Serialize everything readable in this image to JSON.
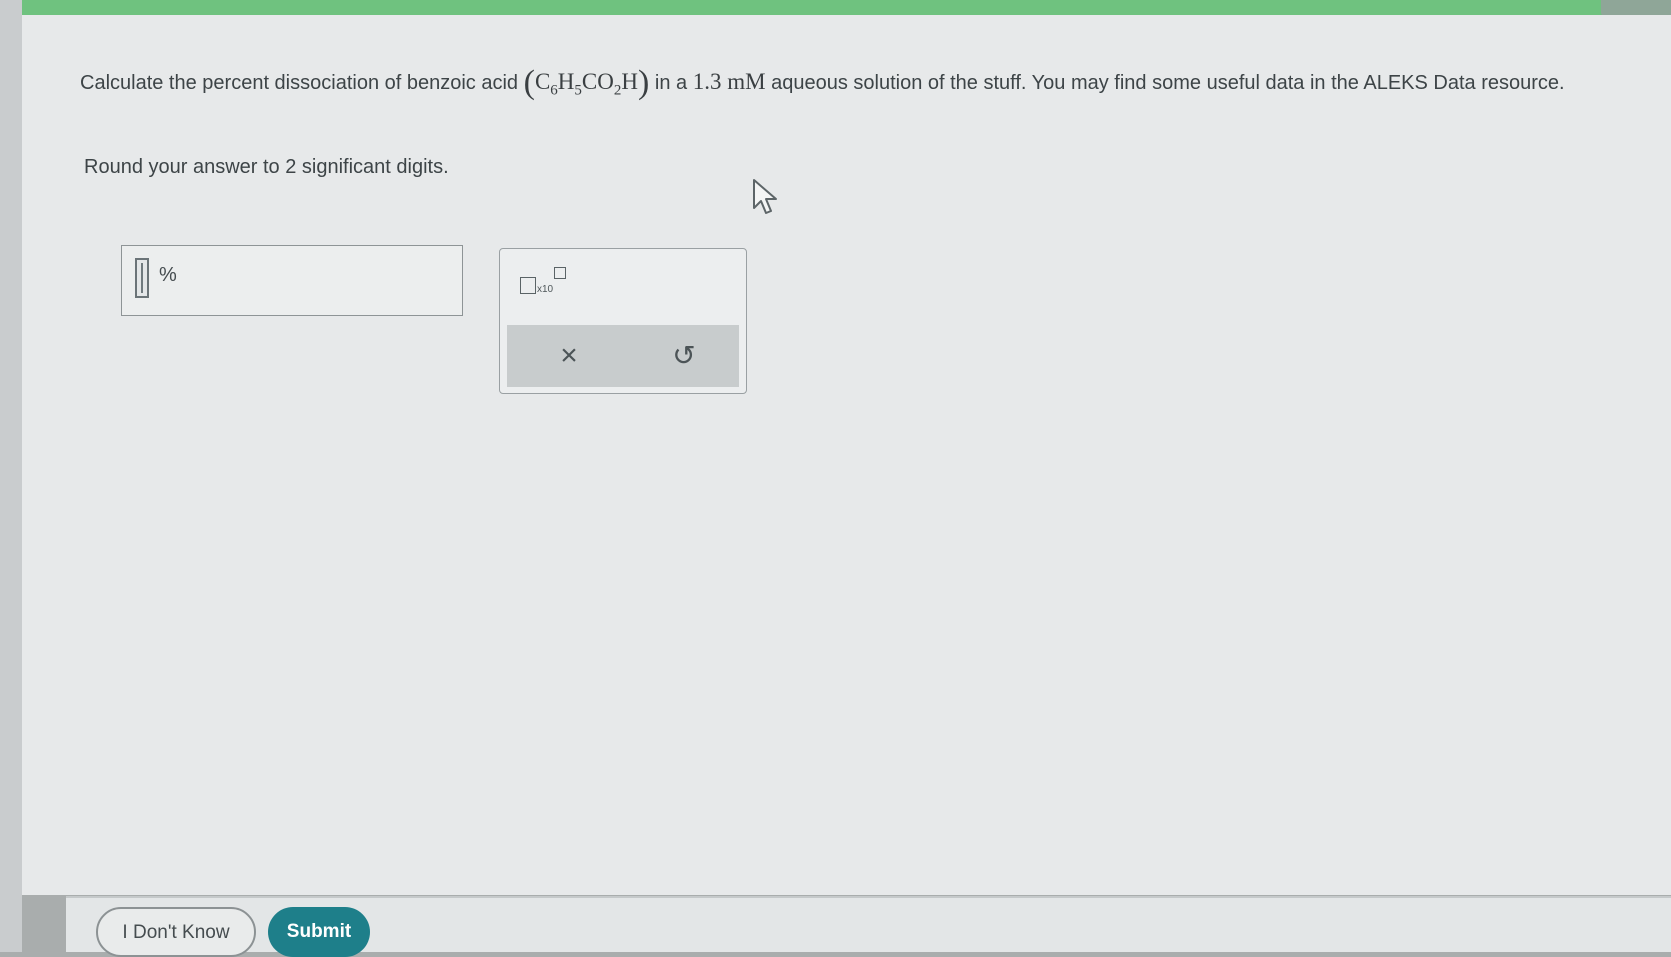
{
  "question": {
    "text_before": "Calculate the percent dissociation of benzoic acid",
    "formula": {
      "open": "(",
      "c": "C",
      "c_sub": "6",
      "h": "H",
      "h_sub": "5",
      "co": "CO",
      "co_sub": "2",
      "h_end": "H",
      "close": ")"
    },
    "text_mid": "in a",
    "concentration": "1.3 mM",
    "text_after": "aqueous solution of the stuff. You may find some useful data in the ALEKS Data resource.",
    "rounding": "Round your answer to 2 significant digits."
  },
  "answer": {
    "value": "",
    "unit": "%"
  },
  "keypad": {
    "sci_label": "x10",
    "clear_symbol": "×",
    "undo_symbol": "↺"
  },
  "footer": {
    "dont_know_label": "I Don't Know",
    "submit_label": "Submit"
  },
  "colors": {
    "accent": "#1e7f8a",
    "topbar": "#6fc27f"
  }
}
